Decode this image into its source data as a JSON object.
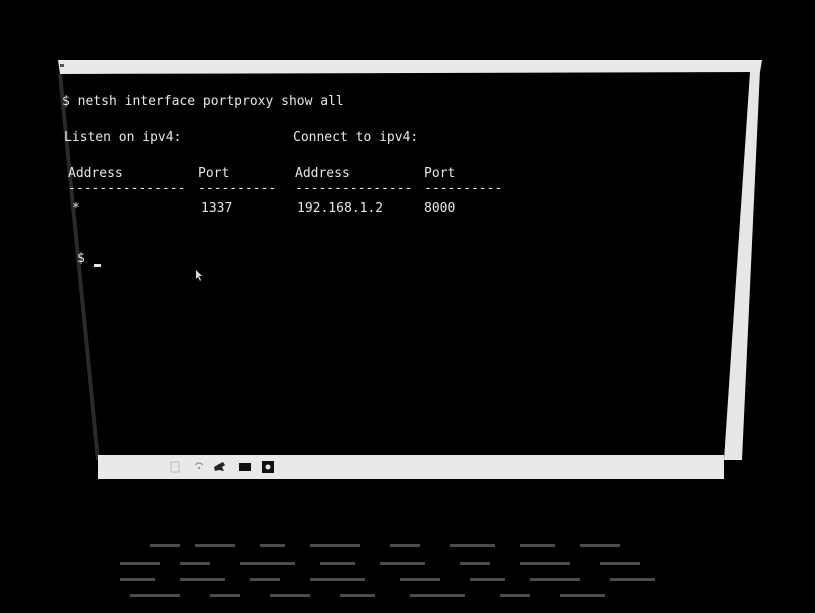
{
  "terminal": {
    "command_line": "$ netsh interface portproxy show all",
    "listen_header": "Listen on ipv4:",
    "connect_header": "Connect to ipv4:",
    "columns": [
      "Address",
      "Port",
      "Address",
      "Port"
    ],
    "separators": [
      "---------------",
      "----------",
      "---------------",
      "----------"
    ],
    "rows": [
      [
        "*",
        "1337",
        "192.168.1.2",
        "8000"
      ]
    ],
    "prompt": "$"
  },
  "taskbar": {
    "icons": [
      "window-icon",
      "wifi-icon",
      "bird-icon",
      "folder-icon",
      "settings-icon"
    ]
  },
  "colors": {
    "background": "#000000",
    "frame": "#e6e6e6",
    "text": "#e8e8e8"
  }
}
